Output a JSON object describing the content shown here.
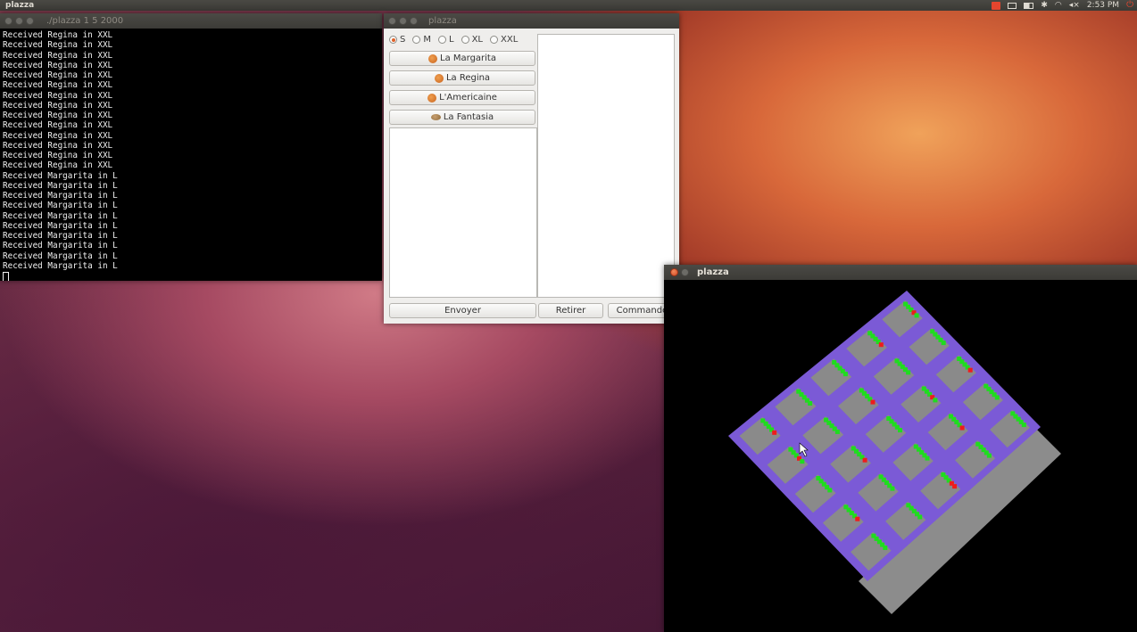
{
  "top_panel": {
    "app_name": "plazza",
    "clock": "2:53 PM",
    "indicators": [
      "notification-icon",
      "mail-icon",
      "battery-icon",
      "bluetooth-icon",
      "wifi-icon",
      "volume-icon",
      "power-icon"
    ]
  },
  "terminal": {
    "title": "./plazza 1 5 2000",
    "lines": [
      "Received Regina in XXL",
      "Received Regina in XXL",
      "Received Regina in XXL",
      "Received Regina in XXL",
      "Received Regina in XXL",
      "Received Regina in XXL",
      "Received Regina in XXL",
      "Received Regina in XXL",
      "Received Regina in XXL",
      "Received Regina in XXL",
      "Received Regina in XXL",
      "Received Regina in XXL",
      "Received Regina in XXL",
      "Received Regina in XXL",
      "Received Margarita in L",
      "Received Margarita in L",
      "Received Margarita in L",
      "Received Margarita in L",
      "Received Margarita in L",
      "Received Margarita in L",
      "Received Margarita in L",
      "Received Margarita in L",
      "Received Margarita in L",
      "Received Margarita in L"
    ]
  },
  "gui": {
    "title": "plazza",
    "sizes": [
      {
        "label": "S",
        "checked": true
      },
      {
        "label": "M",
        "checked": false
      },
      {
        "label": "L",
        "checked": false
      },
      {
        "label": "XL",
        "checked": false
      },
      {
        "label": "XXL",
        "checked": false
      }
    ],
    "pizzas": [
      "La Margarita",
      "La Regina",
      "L'Americaine",
      "La Fantasia"
    ],
    "send_label": "Envoyer",
    "remove_label": "Retirer",
    "order_label": "Commander"
  },
  "glview": {
    "title": "plazza",
    "grid_rows": 5,
    "grid_cols": 5,
    "colors": {
      "frame": "#7b5ad6",
      "cell": "#8a8a8a",
      "shadow": "#8c8c8c",
      "ok": "#1fdc1f",
      "alert": "#ee1c1c"
    }
  }
}
